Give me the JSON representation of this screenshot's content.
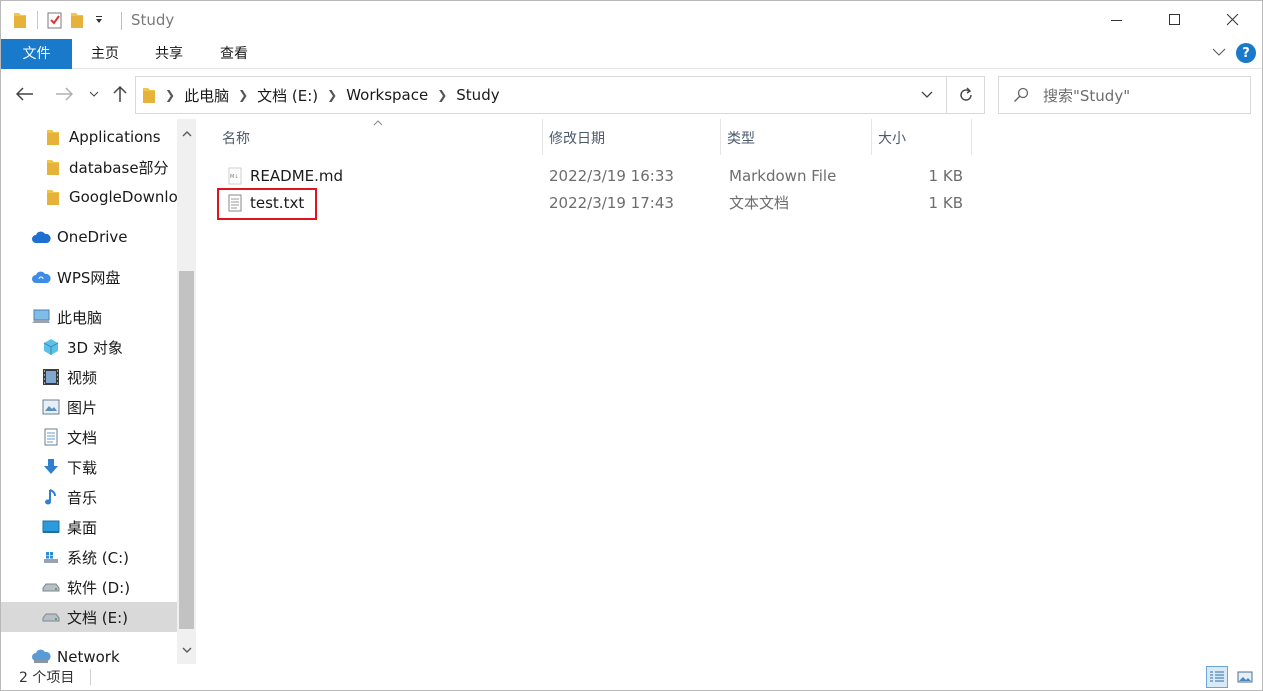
{
  "window": {
    "title": "Study"
  },
  "ribbon": {
    "tabs": [
      "文件",
      "主页",
      "共享",
      "查看"
    ]
  },
  "address": {
    "breadcrumbs": [
      "此电脑",
      "文档 (E:)",
      "Workspace",
      "Study"
    ],
    "search_placeholder": "搜索\"Study\""
  },
  "sidebar": {
    "items": [
      {
        "label": "Applications",
        "icon": "folder-icon"
      },
      {
        "label": "database部分",
        "icon": "folder-icon"
      },
      {
        "label": "GoogleDownlo",
        "icon": "folder-icon"
      },
      {
        "label": "OneDrive",
        "icon": "onedrive-cloud-icon"
      },
      {
        "label": "WPS网盘",
        "icon": "wps-cloud-icon"
      },
      {
        "label": "此电脑",
        "icon": "this-pc-icon"
      },
      {
        "label": "3D 对象",
        "icon": "3d-objects-icon"
      },
      {
        "label": "视频",
        "icon": "videos-icon"
      },
      {
        "label": "图片",
        "icon": "pictures-icon"
      },
      {
        "label": "文档",
        "icon": "documents-icon"
      },
      {
        "label": "下载",
        "icon": "downloads-icon"
      },
      {
        "label": "音乐",
        "icon": "music-icon"
      },
      {
        "label": "桌面",
        "icon": "desktop-icon"
      },
      {
        "label": "系统 (C:)",
        "icon": "system-drive-icon"
      },
      {
        "label": "软件 (D:)",
        "icon": "drive-icon"
      },
      {
        "label": "文档 (E:)",
        "icon": "drive-icon",
        "selected": true
      },
      {
        "label": "Network",
        "icon": "network-icon"
      }
    ]
  },
  "file_list": {
    "columns": {
      "name": "名称",
      "modified": "修改日期",
      "type": "类型",
      "size": "大小"
    },
    "files": [
      {
        "name": "README.md",
        "modified": "2022/3/19 16:33",
        "type": "Markdown File",
        "size": "1 KB",
        "icon": "markdown-file-icon"
      },
      {
        "name": "test.txt",
        "modified": "2022/3/19 17:43",
        "type": "文本文档",
        "size": "1 KB",
        "icon": "text-file-icon",
        "highlighted": true
      }
    ]
  },
  "status": {
    "item_count": "2 个项目"
  },
  "colors": {
    "accent": "#1979ca",
    "highlight_border": "#e0141a",
    "folder_yellow": "#f2c449"
  }
}
